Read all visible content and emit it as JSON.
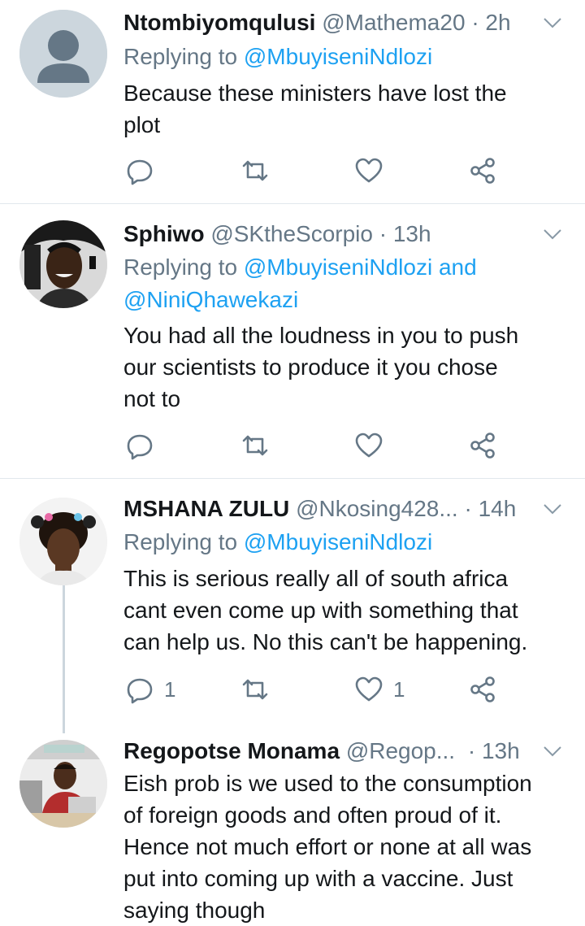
{
  "colors": {
    "link": "#1da1f2",
    "muted": "#657786",
    "text": "#14171a",
    "divider": "#e1e8ed"
  },
  "tweets": [
    {
      "name": "Ntombiyomqulusi",
      "handle": "@Mathema20",
      "separator": "·",
      "time": "2h",
      "reply_prefix": "Replying to",
      "mention_1": "@MbuyiseniNdlozi",
      "lines": [
        "Because these ministers have lost the",
        "plot"
      ],
      "reply_count": "",
      "like_count": "",
      "avatar": "default-avatar"
    },
    {
      "name": "Sphiwo",
      "handle": "@SKtheScorpio",
      "separator": "·",
      "time": "13h",
      "reply_prefix": "Replying to",
      "mention_1": "@MbuyiseniNdlozi",
      "conjunction": "and",
      "mention_2": "@NiniQhawekazi",
      "lines": [
        "You had all the loudness in you to push",
        "our scientists to produce it you chose",
        "not to"
      ],
      "reply_count": "",
      "like_count": "",
      "avatar": "photo-man-headset"
    },
    {
      "name": "MSHANA ZULU",
      "handle": "@Nkosing428...",
      "separator": "·",
      "time": "14h",
      "reply_prefix": "Replying to",
      "mention_1": "@MbuyiseniNdlozi",
      "lines": [
        "This is serious really all of south africa",
        "cant even come up with something that",
        "can help us. No this can't be happening."
      ],
      "reply_count": "1",
      "like_count": "1",
      "avatar": "photo-girl"
    },
    {
      "name": "Regopotse Monama",
      "handle": "@Regop...",
      "separator": "·",
      "time": "13h",
      "lines": [
        "Eish prob is we used to the consumption",
        "of foreign goods and often proud of it.",
        "Hence not much effort or none at all was",
        "put into coming up with a vaccine. Just",
        "saying though"
      ],
      "avatar": "photo-boy-laptop"
    }
  ]
}
